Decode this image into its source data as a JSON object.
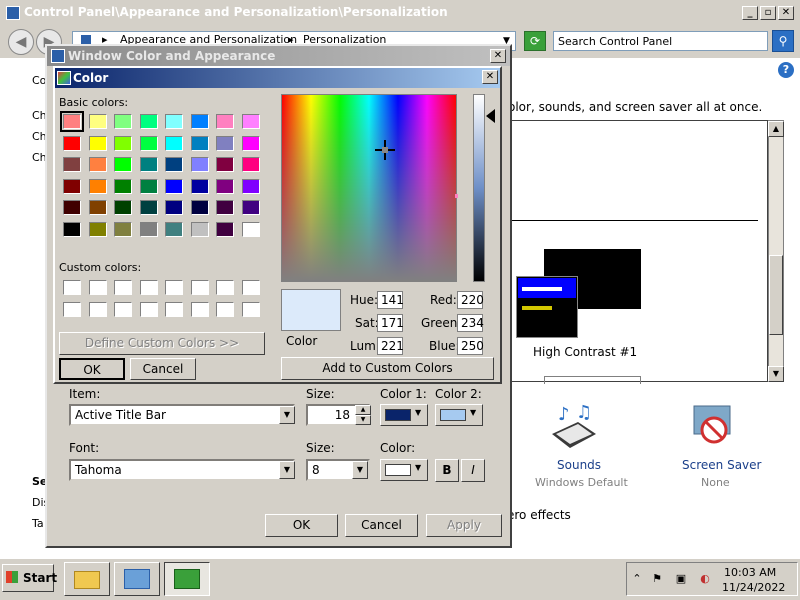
{
  "control_panel": {
    "title": "Control Panel\\Appearance and Personalization\\Personalization",
    "address": {
      "segment1": "Appearance and Personalization",
      "segment2": "Personalization"
    },
    "search_placeholder": "Search Control Panel",
    "description": "olor, sounds, and screen saver all at once.",
    "left_links": [
      "Co",
      "Ch",
      "Ch",
      "Ch",
      "Se",
      "Dis",
      "Ta"
    ],
    "theme_label": "High Contrast #1",
    "sounds": {
      "label": "Sounds",
      "sub": "Windows Default"
    },
    "screen_saver": {
      "label": "Screen Saver",
      "sub": "None"
    },
    "aero_text": "ero effects"
  },
  "window_color_dialog": {
    "title": "Window Color and Appearance",
    "item_label": "Item:",
    "item_value": "Active Title Bar",
    "size_label": "Size:",
    "size_value": "18",
    "color1_label": "Color 1:",
    "color2_label": "Color 2:",
    "color1": "#0a246a",
    "color2": "#a6caf0",
    "font_label": "Font:",
    "font_value": "Tahoma",
    "font_size_label": "Size:",
    "font_size_value": "8",
    "font_color_label": "Color:",
    "font_color": "#ffffff",
    "bold_label": "B",
    "italic_label": "I",
    "ok": "OK",
    "cancel": "Cancel",
    "apply": "Apply"
  },
  "color_dialog": {
    "title": "Color",
    "basic_colors_label": "Basic colors:",
    "custom_colors_label": "Custom colors:",
    "basic_colors": [
      "#ff8080",
      "#ffff80",
      "#80ff80",
      "#00ff80",
      "#80ffff",
      "#0080ff",
      "#ff80c0",
      "#ff80ff",
      "#ff0000",
      "#ffff00",
      "#80ff00",
      "#00ff40",
      "#00ffff",
      "#0080c0",
      "#8080c0",
      "#ff00ff",
      "#804040",
      "#ff8040",
      "#00ff00",
      "#008080",
      "#004080",
      "#8080ff",
      "#800040",
      "#ff0080",
      "#800000",
      "#ff8000",
      "#008000",
      "#008040",
      "#0000ff",
      "#0000a0",
      "#800080",
      "#8000ff",
      "#400000",
      "#804000",
      "#004000",
      "#004040",
      "#000080",
      "#000040",
      "#400040",
      "#400080",
      "#000000",
      "#808000",
      "#808040",
      "#808080",
      "#408080",
      "#c0c0c0",
      "#400040",
      "#ffffff"
    ],
    "selected_index": 0,
    "custom_colors": [
      "#ffffff",
      "#ffffff",
      "#ffffff",
      "#ffffff",
      "#ffffff",
      "#ffffff",
      "#ffffff",
      "#ffffff",
      "#ffffff",
      "#ffffff",
      "#ffffff",
      "#ffffff",
      "#ffffff",
      "#ffffff",
      "#ffffff",
      "#ffffff"
    ],
    "define_custom": "Define Custom Colors >>",
    "ok": "OK",
    "cancel": "Cancel",
    "add_custom": "Add to Custom Colors",
    "color_label": "Color",
    "preview_color": "#dceafa",
    "hue_label": "Hue:",
    "hue": "141",
    "sat_label": "Sat:",
    "sat": "171",
    "lum_label": "Lum:",
    "lum": "221",
    "red_label": "Red:",
    "red": "220",
    "green_label": "Green:",
    "green": "234",
    "blue_label": "Blue:",
    "blue": "250"
  },
  "taskbar": {
    "start": "Start",
    "time": "10:03 AM",
    "date": "11/24/2022"
  }
}
